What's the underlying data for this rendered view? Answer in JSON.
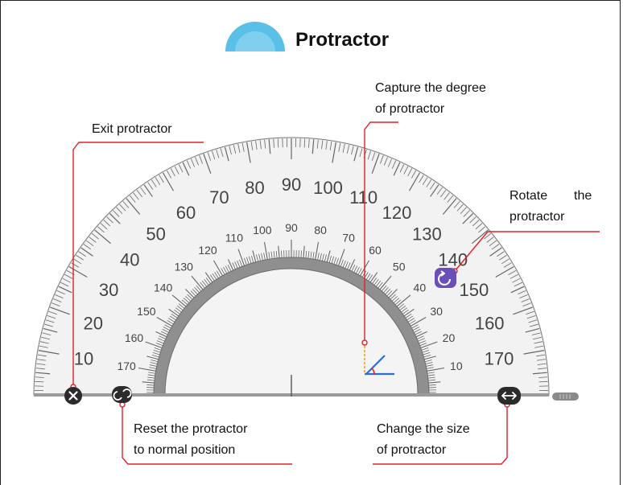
{
  "header": {
    "title": "Protractor",
    "icon": "half-dome-protractor-icon",
    "icon_color": "#5bc0e8"
  },
  "callouts": {
    "exit": "Exit protractor",
    "capture_line1": "Capture the degree",
    "capture_line2": "of protractor",
    "rotate_line1": "Rotate",
    "rotate_line1b": "the",
    "rotate_line2": "protractor",
    "reset_line1": "Reset the protractor",
    "reset_line2": "to normal position",
    "size_line1": "Change the size",
    "size_line2": "of protractor"
  },
  "protractor": {
    "outer_scale": [
      "170",
      "160",
      "150",
      "140",
      "130",
      "120",
      "110",
      "100",
      "90",
      "80",
      "70",
      "60",
      "50",
      "40",
      "30",
      "20",
      "10"
    ],
    "inner_scale": [
      "10",
      "20",
      "30",
      "40",
      "50",
      "60",
      "70",
      "80",
      "90",
      "100",
      "110",
      "120",
      "130",
      "140",
      "150",
      "160",
      "170"
    ],
    "controls": {
      "close_icon": "close-icon",
      "reset_icon": "reset-icon",
      "rotate_icon": "rotate-icon",
      "resize_icon": "resize-horizontal-icon",
      "drag_handle_icon": "drag-handle-icon",
      "angle_icon": "angle-capture-icon"
    }
  },
  "colors": {
    "callout_line": "#e0202a",
    "accent_blue": "#2a6fd6",
    "angle_orange": "#f0a020",
    "rotate_button": "#6b4fb8",
    "ring_gray": "#8f8f8f"
  }
}
